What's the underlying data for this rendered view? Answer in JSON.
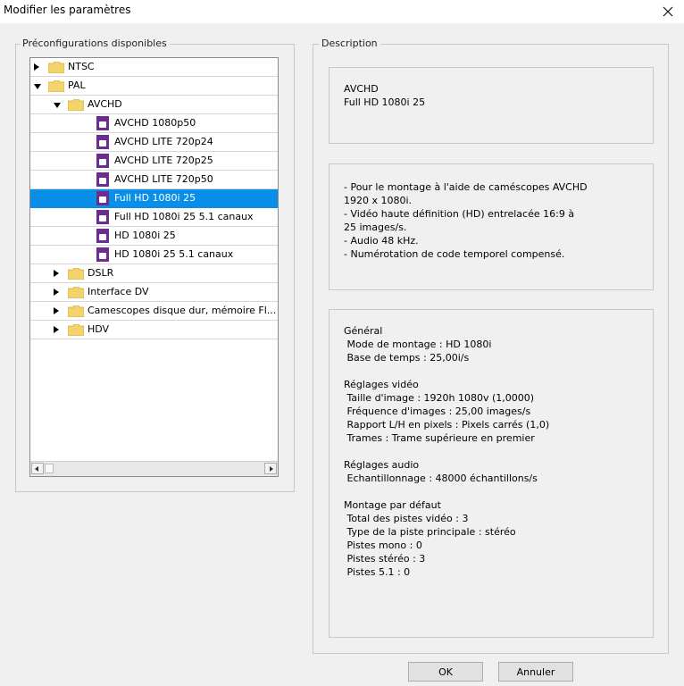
{
  "window": {
    "title": "Modifier les paramètres"
  },
  "presets_group": {
    "label": "Préconfigurations disponibles"
  },
  "description_group": {
    "label": "Description"
  },
  "tree": [
    {
      "label": "NTSC",
      "kind": "folder",
      "expanded": false
    },
    {
      "label": "PAL",
      "kind": "folder",
      "expanded": true
    },
    {
      "label": "AVCHD",
      "kind": "folder",
      "expanded": true
    },
    {
      "label": "AVCHD 1080p50",
      "kind": "preset"
    },
    {
      "label": "AVCHD LITE 720p24",
      "kind": "preset"
    },
    {
      "label": "AVCHD LITE 720p25",
      "kind": "preset"
    },
    {
      "label": "AVCHD LITE 720p50",
      "kind": "preset"
    },
    {
      "label": "Full HD 1080i 25",
      "kind": "preset",
      "selected": true
    },
    {
      "label": "Full HD 1080i 25 5.1 canaux",
      "kind": "preset"
    },
    {
      "label": "HD 1080i 25",
      "kind": "preset"
    },
    {
      "label": "HD 1080i 25 5.1 canaux",
      "kind": "preset"
    },
    {
      "label": "DSLR",
      "kind": "folder",
      "expanded": false
    },
    {
      "label": "Interface DV",
      "kind": "folder",
      "expanded": false
    },
    {
      "label": "Camescopes disque dur, mémoire Fl...",
      "kind": "folder",
      "expanded": false
    },
    {
      "label": "HDV",
      "kind": "folder",
      "expanded": false
    }
  ],
  "description": {
    "summary": "AVCHD\nFull HD 1080i 25",
    "notes": "- Pour le montage à l'aide de caméscopes AVCHD\n1920 x 1080i.\n- Vidéo haute définition (HD) entrelacée 16:9 à\n25 images/s.\n- Audio 48 kHz.\n- Numérotation de code temporel compensé.",
    "settings": "Général\n Mode de montage : HD 1080i\n Base de temps : 25,00i/s\n\nRéglages vidéo\n Taille d'image : 1920h 1080v (1,0000)\n Fréquence d'images : 25,00 images/s\n Rapport L/H en pixels : Pixels carrés (1,0)\n Trames : Trame supérieure en premier\n\nRéglages audio\n Echantillonnage : 48000 échantillons/s\n\nMontage par défaut\n Total des pistes vidéo : 3\n Type de la piste principale : stéréo\n Pistes mono : 0\n Pistes stéréo : 3\n Pistes 5.1 : 0"
  },
  "buttons": {
    "ok": "OK",
    "cancel": "Annuler"
  },
  "colors": {
    "selection": "#0a8fe8",
    "folder": "#f3d36b",
    "preset_icon": "#6b2d8f"
  }
}
